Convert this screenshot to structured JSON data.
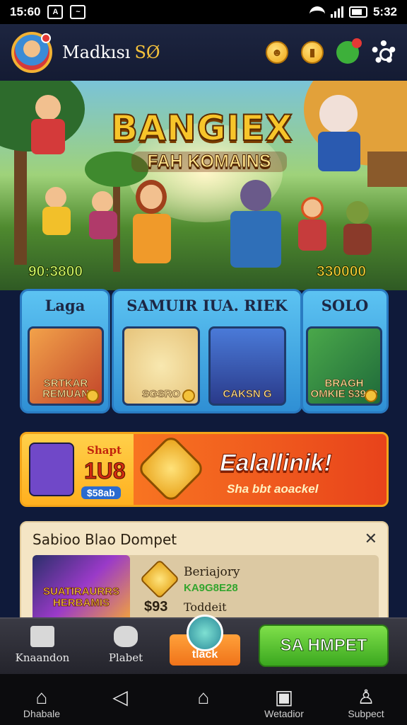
{
  "status_bar": {
    "time_left": "15:60",
    "time_right": "5:32"
  },
  "header": {
    "username": "Madkısı",
    "level": "SØ"
  },
  "hero": {
    "title": "BANGIEX",
    "subtitle": "FAH KOMAINS",
    "score_left": "90:3800",
    "score_right": "330000"
  },
  "categories": [
    {
      "title": "Laga",
      "tiles": [
        {
          "label": "SRTKAR REMUAN"
        }
      ]
    },
    {
      "title": "SAMUIR IUA. RIEK",
      "tiles": [
        {
          "label": "SGSRO"
        },
        {
          "label": "CAKSN G"
        }
      ]
    },
    {
      "title": "SOLO",
      "tiles": [
        {
          "label": "BRAGH OMKIE $3900"
        }
      ]
    }
  ],
  "promo": {
    "small": "Shapt",
    "big": "1U8",
    "pill": "$58ab",
    "headline": "Ealallinik!",
    "subline": "Sha bbt aoackel"
  },
  "reward": {
    "title": "Sabioo Blao Dompet",
    "thumb_label": "SUATIRAURRS HERBAMIS",
    "category": "Beriajory",
    "code": "KA9G8E28",
    "price": "$93",
    "status": "Toddeit"
  },
  "action_bar": {
    "left_label": "Knaandon",
    "second_label": "Plabet",
    "center_label": "tlack",
    "cta_label": "SA HMPET"
  },
  "nav": {
    "home_label": "Dhabale",
    "wallet_label": "Wetadior",
    "support_label": "Subpect"
  },
  "colors": {
    "accent": "#f6c33c",
    "cta": "#3ba81f",
    "promo": "#e8431b"
  }
}
